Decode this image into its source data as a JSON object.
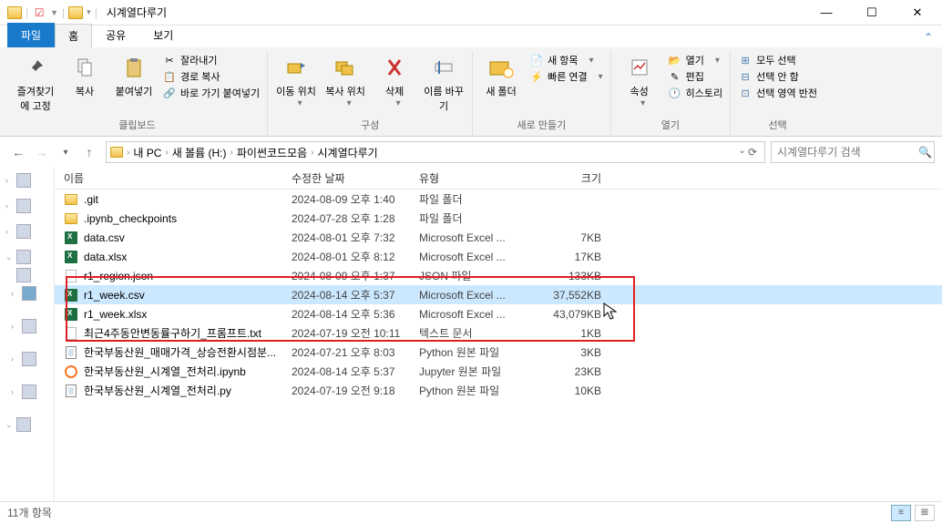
{
  "title": "시계열다루기",
  "tabs": {
    "file": "파일",
    "home": "홈",
    "share": "공유",
    "view": "보기"
  },
  "ribbon": {
    "clipboard": {
      "pin": "즐겨찾기에 고정",
      "copy": "복사",
      "paste": "붙여넣기",
      "cut": "잘라내기",
      "copypath": "경로 복사",
      "pasteshortcut": "바로 가기 붙여넣기",
      "label": "클립보드"
    },
    "organize": {
      "moveto": "이동 위치",
      "copyto": "복사 위치",
      "delete": "삭제",
      "rename": "이름 바꾸기",
      "label": "구성"
    },
    "new": {
      "newfolder": "새 폴더",
      "newitem": "새 항목",
      "easyaccess": "빠른 연결",
      "label": "새로 만들기"
    },
    "open": {
      "properties": "속성",
      "open": "열기",
      "edit": "편집",
      "history": "히스토리",
      "label": "열기"
    },
    "select": {
      "all": "모두 선택",
      "none": "선택 안 함",
      "invert": "선택 영역 반전",
      "label": "선택"
    }
  },
  "breadcrumb": {
    "segs": [
      "내 PC",
      "새 볼륨 (H:)",
      "파이썬코드모음",
      "시계열다루기"
    ]
  },
  "search_placeholder": "시계열다루기 검색",
  "columns": {
    "name": "이름",
    "date": "수정한 날짜",
    "type": "유형",
    "size": "크기"
  },
  "files": [
    {
      "name": ".git",
      "date": "2024-08-09 오후 1:40",
      "type": "파일 폴더",
      "size": "",
      "icon": "folder",
      "selected": false
    },
    {
      "name": ".ipynb_checkpoints",
      "date": "2024-07-28 오후 1:28",
      "type": "파일 폴더",
      "size": "",
      "icon": "folder",
      "selected": false
    },
    {
      "name": "data.csv",
      "date": "2024-08-01 오후 7:32",
      "type": "Microsoft Excel ...",
      "size": "7KB",
      "icon": "excel",
      "selected": false
    },
    {
      "name": "data.xlsx",
      "date": "2024-08-01 오후 8:12",
      "type": "Microsoft Excel ...",
      "size": "17KB",
      "icon": "excel",
      "selected": false
    },
    {
      "name": "r1_region.json",
      "date": "2024-08-09 오후 1:37",
      "type": "JSON 파일",
      "size": "133KB",
      "icon": "json",
      "selected": false
    },
    {
      "name": "r1_week.csv",
      "date": "2024-08-14 오후 5:37",
      "type": "Microsoft Excel ...",
      "size": "37,552KB",
      "icon": "excel",
      "selected": true
    },
    {
      "name": "r1_week.xlsx",
      "date": "2024-08-14 오후 5:36",
      "type": "Microsoft Excel ...",
      "size": "43,079KB",
      "icon": "excel",
      "selected": false
    },
    {
      "name": "최근4주동안변동률구하기_프롬프트.txt",
      "date": "2024-07-19 오전 10:11",
      "type": "텍스트 문서",
      "size": "1KB",
      "icon": "text",
      "selected": false
    },
    {
      "name": "한국부동산원_매매가격_상승전환시점분...",
      "date": "2024-07-21 오후 8:03",
      "type": "Python 원본 파일",
      "size": "3KB",
      "icon": "py",
      "selected": false
    },
    {
      "name": "한국부동산원_시계열_전처리.ipynb",
      "date": "2024-08-14 오후 5:37",
      "type": "Jupyter 원본 파일",
      "size": "23KB",
      "icon": "jup",
      "selected": false
    },
    {
      "name": "한국부동산원_시계열_전처리.py",
      "date": "2024-07-19 오전 9:18",
      "type": "Python 원본 파일",
      "size": "10KB",
      "icon": "py",
      "selected": false
    }
  ],
  "status": "11개 항목"
}
